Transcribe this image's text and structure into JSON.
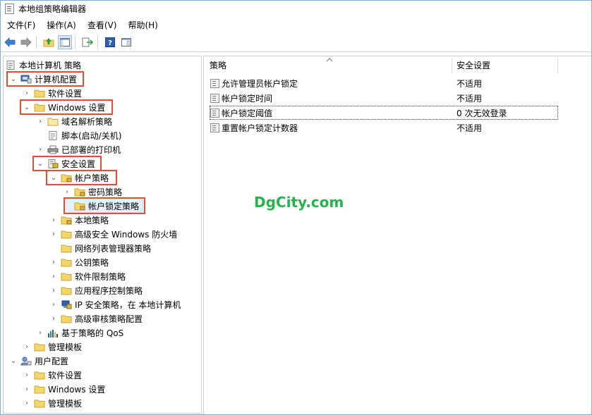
{
  "window": {
    "title": "本地组策略编辑器"
  },
  "menu": {
    "items": [
      "文件(F)",
      "操作(A)",
      "查看(V)",
      "帮助(H)"
    ]
  },
  "tree": {
    "root": "本地计算机 策略",
    "nodes": [
      "计算机配置",
      "软件设置",
      "Windows 设置",
      "域名解析策略",
      "脚本(启动/关机)",
      "已部署的打印机",
      "安全设置",
      "帐户策略",
      "密码策略",
      "帐户锁定策略",
      "本地策略",
      "高级安全 Windows 防火墙",
      "网络列表管理器策略",
      "公钥策略",
      "软件限制策略",
      "应用程序控制策略",
      "IP 安全策略，在 本地计算机",
      "高级审核策略配置",
      "基于策略的 QoS",
      "管理模板",
      "用户配置",
      "软件设置",
      "Windows 设置",
      "管理模板"
    ]
  },
  "list": {
    "columns": [
      "策略",
      "安全设置"
    ],
    "rows": [
      {
        "policy": "允许管理员帐户锁定",
        "setting": "不适用"
      },
      {
        "policy": "帐户锁定时间",
        "setting": "不适用"
      },
      {
        "policy": "帐户锁定阈值",
        "setting": "0 次无效登录"
      },
      {
        "policy": "重置帐户锁定计数器",
        "setting": "不适用"
      }
    ]
  },
  "watermark": "DgCity.com",
  "colors": {
    "highlight": "#e4502f",
    "watermark": "#27b34c",
    "folder": "#f5d66e"
  }
}
